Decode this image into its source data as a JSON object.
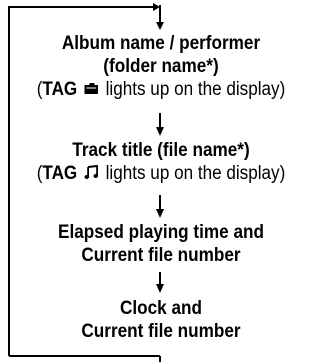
{
  "steps": [
    {
      "lines": [
        "Album name / performer",
        "(folder name*)"
      ],
      "note": {
        "prefix": "(",
        "tag": "TAG",
        "icon": "folder-icon",
        "suffix": "lights up on the display)"
      }
    },
    {
      "lines": [
        "Track title (file name*)"
      ],
      "note": {
        "prefix": "(",
        "tag": "TAG",
        "icon": "music-note-icon",
        "suffix": "lights up on the display)"
      }
    },
    {
      "lines": [
        "Elapsed playing time and",
        "Current file number"
      ]
    },
    {
      "lines": [
        "Clock and",
        "Current file number"
      ]
    }
  ]
}
